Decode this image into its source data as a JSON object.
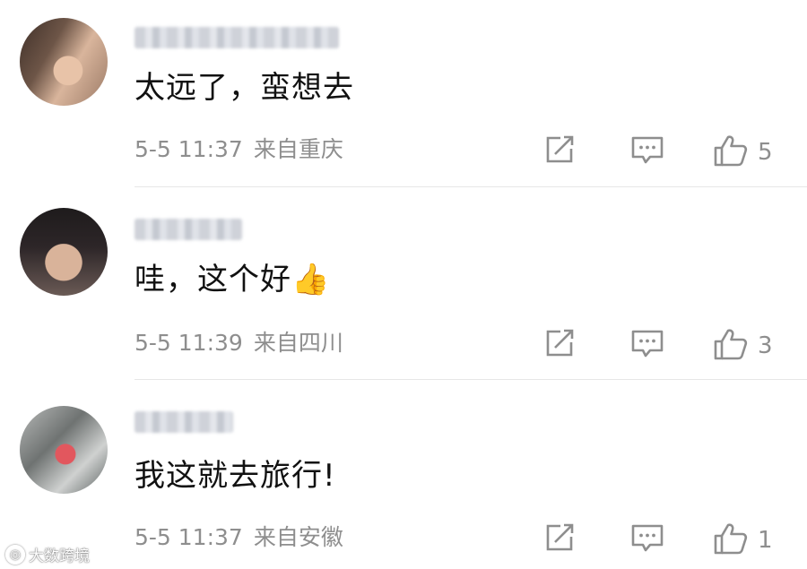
{
  "comments": [
    {
      "text": "太远了，蛮想去",
      "time": "5-5 11:37",
      "location": "来自重庆",
      "likes": "5"
    },
    {
      "text": "哇，这个好👍",
      "time": "5-5 11:39",
      "location": "来自四川",
      "likes": "3"
    },
    {
      "text": "我这就去旅行!",
      "time": "5-5 11:37",
      "location": "来自安徽",
      "likes": "1"
    }
  ],
  "icons": {
    "share": "share-icon",
    "reply": "comment-icon",
    "like": "thumbs-up-icon"
  },
  "colors": {
    "text": "#111111",
    "meta": "#8e8e8e",
    "icon": "#8e8e8e",
    "divider": "#e7e7e7"
  },
  "watermark": "大数跨境"
}
